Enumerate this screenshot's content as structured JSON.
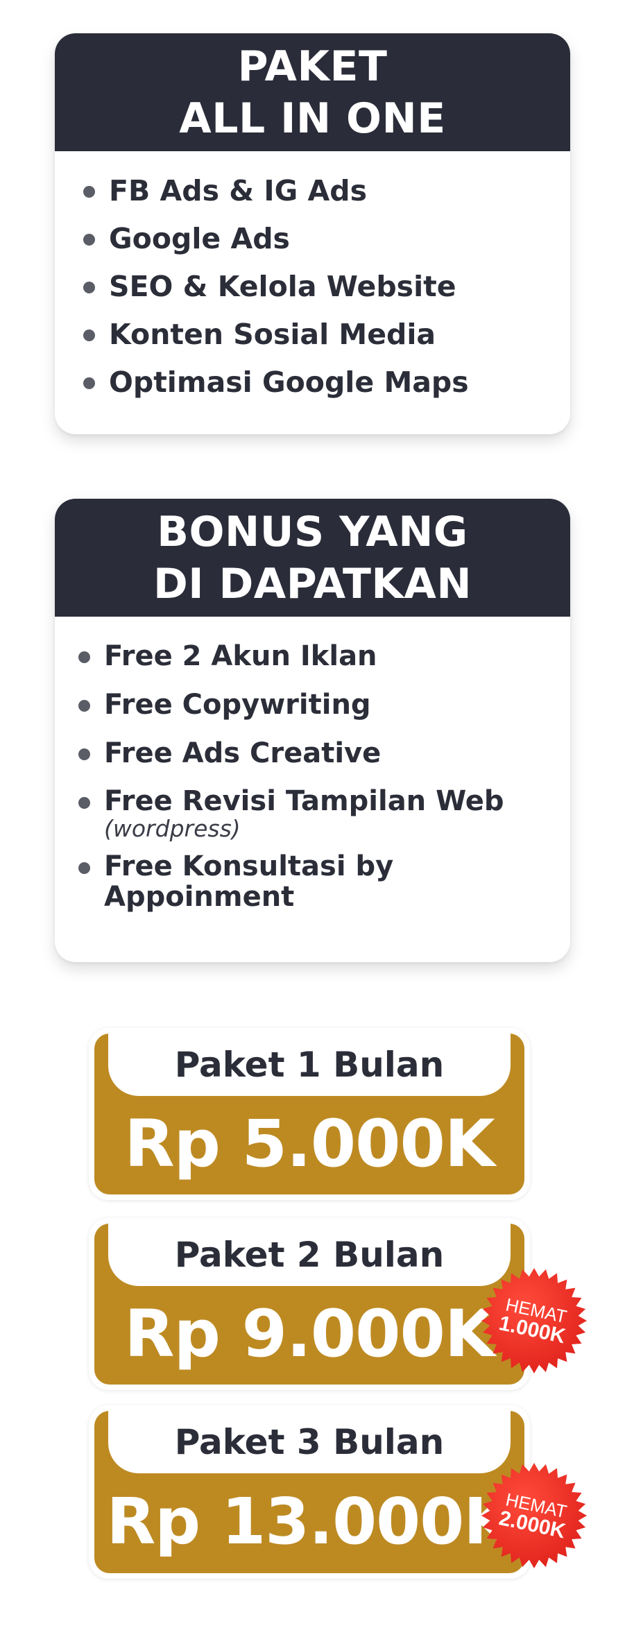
{
  "package_card": {
    "title_line1": "PAKET",
    "title_line2": "ALL IN ONE",
    "items": [
      "FB Ads & IG Ads",
      "Google Ads",
      "SEO & Kelola Website",
      "Konten Sosial Media",
      "Optimasi Google Maps"
    ]
  },
  "bonus_card": {
    "title_line1": "BONUS YANG",
    "title_line2": "DI DAPATKAN",
    "items": [
      {
        "text": "Free 2 Akun Iklan"
      },
      {
        "text": "Free Copywriting"
      },
      {
        "text": "Free Ads Creative"
      },
      {
        "text": "Free Revisi Tampilan Web",
        "note": "(wordpress)"
      },
      {
        "text_line1": "Free Konsultasi by",
        "text_line2": "Appoinment"
      }
    ]
  },
  "prices": [
    {
      "label": "Paket 1 Bulan",
      "value": "Rp 5.000K"
    },
    {
      "label": "Paket 2 Bulan",
      "value": "Rp 9.000K",
      "badge_top": "HEMAT",
      "badge_bottom": "1.000K"
    },
    {
      "label": "Paket 3 Bulan",
      "value": "Rp 13.000K",
      "badge_top": "HEMAT",
      "badge_bottom": "2.000K"
    }
  ],
  "colors": {
    "header_dark": "#2a2c39",
    "gold": "#bd8a22",
    "badge_red": "#e0231c",
    "text_dark": "#2b2d38"
  }
}
